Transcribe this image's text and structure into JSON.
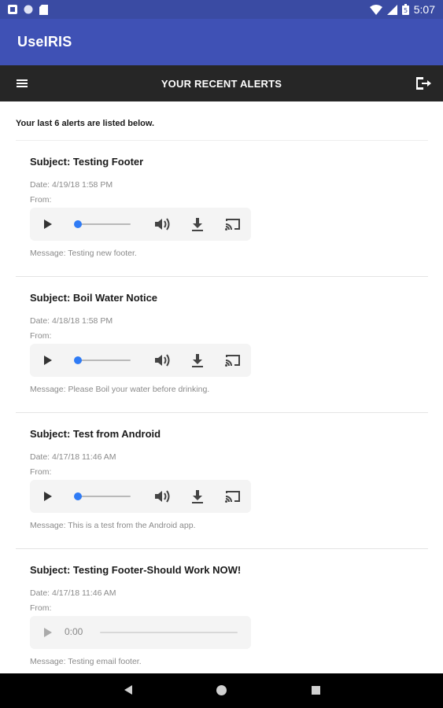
{
  "status_bar": {
    "time": "5:07",
    "icons": [
      "notification-icon",
      "circle-icon",
      "sd-card-icon",
      "wifi-icon",
      "signal-icon",
      "battery-icon"
    ]
  },
  "app": {
    "title": "UseIRIS"
  },
  "nav": {
    "title": "YOUR RECENT ALERTS",
    "menu_icon": "hamburger-menu-icon",
    "logout_icon": "logout-icon"
  },
  "intro": "Your last 6 alerts are listed below.",
  "alerts": [
    {
      "subject": "Subject: Testing Footer",
      "date": "Date: 4/19/18 1:58 PM",
      "from": "From:",
      "message": "Message: Testing new footer.",
      "player": {
        "played_fraction": 0.0,
        "time": ""
      }
    },
    {
      "subject": "Subject: Boil Water Notice",
      "date": "Date: 4/18/18 1:58 PM",
      "from": "From:",
      "message": "Message: Please Boil your water before drinking.",
      "player": {
        "played_fraction": 0.0,
        "time": ""
      }
    },
    {
      "subject": "Subject: Test from Android",
      "date": "Date: 4/17/18 11:46 AM",
      "from": "From:",
      "message": "Message: This is a test from the Android app.",
      "player": {
        "played_fraction": 0.0,
        "time": ""
      }
    },
    {
      "subject": "Subject: Testing Footer-Should Work NOW!",
      "date": "Date: 4/17/18 11:46 AM",
      "from": "From:",
      "message": "Message: Testing email footer.",
      "player": {
        "played_fraction": 0.0,
        "time": "0:00"
      }
    }
  ],
  "colors": {
    "status_bar": "#3a4ba3",
    "app_bar": "#3f51b5",
    "nav_bar": "#262626",
    "player_knob": "#2f7bf5"
  }
}
